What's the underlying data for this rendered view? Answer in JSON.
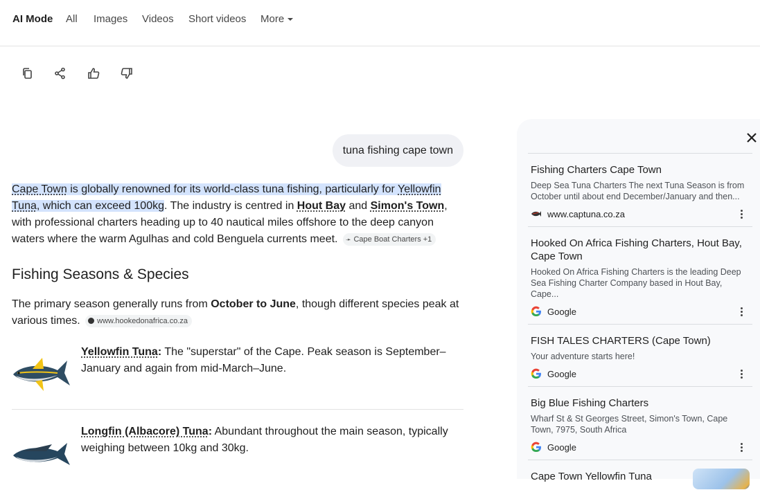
{
  "nav": {
    "tabs": [
      {
        "label": "AI Mode",
        "active": true
      },
      {
        "label": "All"
      },
      {
        "label": "Images"
      },
      {
        "label": "Videos"
      },
      {
        "label": "Short videos"
      },
      {
        "label": "More"
      }
    ]
  },
  "actions": {
    "icons": [
      "copy-icon",
      "share-icon",
      "thumbs-up-icon",
      "thumbs-down-icon"
    ]
  },
  "query": "tuna fishing cape town",
  "answer": {
    "intro": {
      "p1": "Cape Town",
      "p2": " is globally renowned for its world-class tuna fishing, particularly for ",
      "p3": "Yellowfin Tuna",
      "p4": ", which can exceed 100kg",
      "p5": ". The industry is centred in ",
      "p6": "Hout Bay",
      "p7": " and ",
      "p8": "Simon's Town",
      "p9": ", with professional charters heading up to 40 nautical miles offshore to the deep canyon waters where the warm Agulhas and cold Benguela currents meet.",
      "chip": "Cape Boat Charters +1"
    },
    "section_title": "Fishing Seasons & Species",
    "season": {
      "p1": "The primary season generally runs from ",
      "p2": "October to June",
      "p3": ", though different species peak at various times.",
      "chip": "www.hookedonafrica.co.za"
    },
    "species": [
      {
        "name": "Yellowfin Tuna",
        "colon": ":",
        "text": " The \"superstar\" of the Cape. Peak season is September–January and again from mid-March–June."
      },
      {
        "name": "Longfin (Albacore) Tuna",
        "colon": ":",
        "text": " Abundant throughout the main season, typically weighing between 10kg and 30kg."
      }
    ]
  },
  "sources": [
    {
      "title": "Fishing Charters Cape Town",
      "desc": "Deep Sea Tuna Charters The next Tuna Season is from October until about end December/January and then...",
      "site": "www.captuna.co.za",
      "icon": "fish-logo-icon"
    },
    {
      "title": "Hooked On Africa Fishing Charters, Hout Bay, Cape Town",
      "desc": "Hooked On Africa Fishing Charters is the leading Deep Sea Fishing Charter Company based in Hout Bay, Cape...",
      "site": "Google",
      "icon": "google-icon"
    },
    {
      "title": "FISH TALES CHARTERS (Cape Town)",
      "desc": "Your adventure starts here!",
      "site": "Google",
      "icon": "google-icon"
    },
    {
      "title": "Big Blue Fishing Charters",
      "desc": "Wharf St & St Georges Street, Simon's Town, Cape Town, 7975, South Africa",
      "site": "Google",
      "icon": "google-icon"
    },
    {
      "title": "Cape Town Yellowfin Tuna",
      "desc": "",
      "site": "",
      "icon": ""
    }
  ],
  "colors": {
    "highlight": "#d3e3fd",
    "panel_bg": "#f8f9fb",
    "accent": "#1a73e8"
  }
}
